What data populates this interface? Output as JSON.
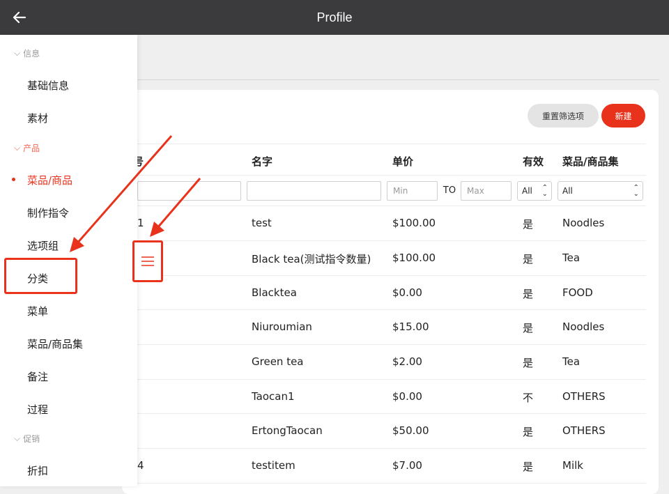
{
  "header": {
    "title": "Profile",
    "back_icon": "arrow-left-icon"
  },
  "toolbar": {
    "reset_label": "重置筛选项",
    "new_label": "新建"
  },
  "columns": {
    "id_partial": "号",
    "name": "名字",
    "price": "单价",
    "valid": "有效",
    "collection": "菜品/商品集"
  },
  "filters": {
    "min_placeholder": "Min",
    "to_label": "TO",
    "max_placeholder": "Max",
    "valid_value": "All",
    "collection_value": "All"
  },
  "rows": [
    {
      "id": "1",
      "name": "test",
      "price": "$100.00",
      "valid": "是",
      "collection": "Noodles"
    },
    {
      "id": "",
      "name": "Black tea(测试指令数量)",
      "price": "$100.00",
      "valid": "是",
      "collection": "Tea"
    },
    {
      "id": "",
      "name": "Blacktea",
      "price": "$0.00",
      "valid": "是",
      "collection": "FOOD"
    },
    {
      "id": "",
      "name": "Niuroumian",
      "price": "$15.00",
      "valid": "是",
      "collection": "Noodles"
    },
    {
      "id": "",
      "name": "Green tea",
      "price": "$2.00",
      "valid": "是",
      "collection": "Tea"
    },
    {
      "id": "",
      "name": "Taocan1",
      "price": "$0.00",
      "valid": "不",
      "collection": "OTHERS"
    },
    {
      "id": "",
      "name": "ErtongTaocan",
      "price": "$50.00",
      "valid": "是",
      "collection": "OTHERS"
    },
    {
      "id": "4",
      "name": "testitem",
      "price": "$7.00",
      "valid": "是",
      "collection": "Milk"
    }
  ],
  "sidebar": {
    "sections": [
      {
        "label": "信息"
      },
      {
        "label": "产品"
      },
      {
        "label": "促销"
      }
    ],
    "items": [
      {
        "label": "基础信息"
      },
      {
        "label": "素材"
      },
      {
        "label": "菜品/商品"
      },
      {
        "label": "制作指令"
      },
      {
        "label": "选项组"
      },
      {
        "label": "分类"
      },
      {
        "label": "菜单"
      },
      {
        "label": "菜品/商品集"
      },
      {
        "label": "备注"
      },
      {
        "label": "过程"
      },
      {
        "label": "折扣"
      }
    ]
  },
  "colors": {
    "accent": "#e8321b",
    "topbar": "#3b3b3d"
  }
}
